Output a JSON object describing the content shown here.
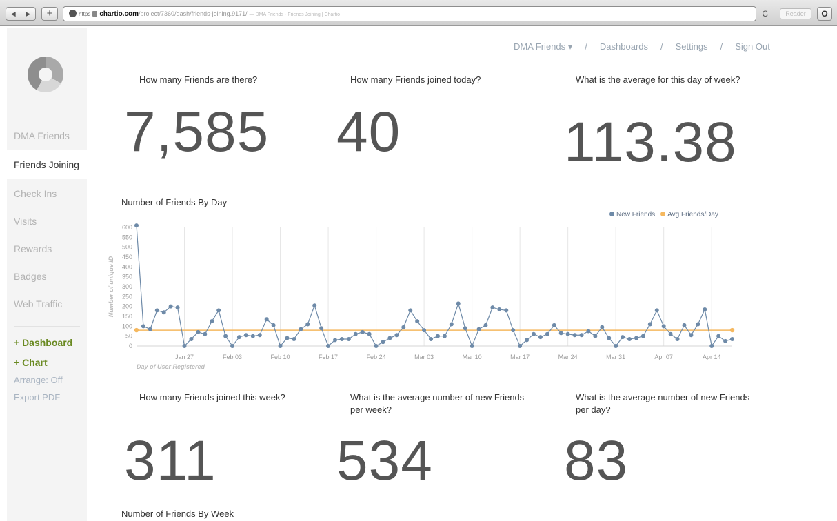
{
  "browser": {
    "nav_back": "◀",
    "nav_fwd": "▶",
    "new_tab": "+",
    "https": "https",
    "host": "chartio.com",
    "path": "/project/7360/dash/friends-joining.9171/",
    "page_title": "— DMA Friends - Friends Joining | Chartio",
    "reload": "C",
    "reader": "Reader",
    "ext": "O"
  },
  "topnav": {
    "items": [
      "DMA Friends ▾",
      "Dashboards",
      "Settings",
      "Sign Out"
    ],
    "separator": "/"
  },
  "sidebar": {
    "items": [
      "DMA Friends",
      "Friends Joining",
      "Check Ins",
      "Visits",
      "Rewards",
      "Badges",
      "Web Traffic"
    ],
    "active": "Friends Joining",
    "add_dashboard": "+ Dashboard",
    "add_chart": "+ Chart",
    "arrange": "Arrange: Off",
    "export": "Export PDF"
  },
  "kpis_top": [
    {
      "question": "How many Friends are there?",
      "value": "7,585"
    },
    {
      "question": "How many Friends joined today?",
      "value": "40"
    },
    {
      "question": "What is the average for this day of week?",
      "value": "113.38"
    }
  ],
  "kpis_bottom": [
    {
      "question": "How many Friends joined this week?",
      "value": "311"
    },
    {
      "question": "What is the average number of new Friends per week?",
      "value": "534"
    },
    {
      "question": "What is the average number of new Friends per day?",
      "value": "83"
    }
  ],
  "chart_title": "Number of Friends By Day",
  "section2_title": "Number of Friends By Week",
  "colors": {
    "series": "#6e8aa8",
    "avg": "#f5b85f"
  },
  "chart_data": {
    "type": "line",
    "title": "Number of Friends By Day",
    "xlabel": "Day of User Registered",
    "ylabel": "Number of unique ID",
    "ylim": [
      0,
      600
    ],
    "y_ticks": [
      0,
      50,
      100,
      150,
      200,
      250,
      300,
      350,
      400,
      450,
      500,
      550,
      600
    ],
    "x_tick_labels": [
      "Jan 27",
      "Feb 03",
      "Feb 10",
      "Feb 17",
      "Feb 24",
      "Mar 03",
      "Mar 10",
      "Mar 17",
      "Mar 24",
      "Mar 31",
      "Apr 07",
      "Apr 14"
    ],
    "grid": true,
    "legend_position": "top-right",
    "series": [
      {
        "name": "New Friends",
        "color": "#6e8aa8",
        "values": [
          610,
          100,
          85,
          180,
          170,
          200,
          195,
          0,
          35,
          70,
          60,
          125,
          180,
          50,
          0,
          45,
          55,
          50,
          55,
          135,
          105,
          0,
          40,
          35,
          85,
          110,
          205,
          90,
          0,
          30,
          35,
          35,
          60,
          70,
          60,
          0,
          20,
          40,
          55,
          95,
          180,
          125,
          80,
          35,
          50,
          50,
          110,
          215,
          90,
          0,
          85,
          105,
          195,
          185,
          180,
          80,
          0,
          30,
          60,
          45,
          60,
          105,
          65,
          60,
          55,
          55,
          75,
          50,
          95,
          40,
          0,
          45,
          35,
          40,
          50,
          110,
          180,
          100,
          60,
          35,
          105,
          55,
          110,
          185,
          0,
          50,
          25,
          35
        ]
      },
      {
        "name": "Avg Friends/Day",
        "color": "#f5b85f",
        "constant": 80
      }
    ]
  }
}
